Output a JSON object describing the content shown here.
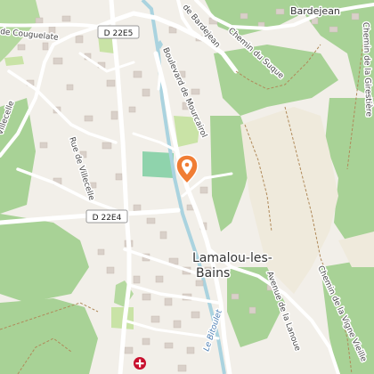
{
  "map": {
    "labels": {
      "road_coupeulate": "de Couguelate",
      "road_bardejean": "de Bardejean",
      "place_bardejean": "Bardejean",
      "road_chemin_suque": "Chemin du Suque",
      "road_girestiere": "Chemin de la Girestière",
      "road_mourcairol": "Boulevard de Mourcairol",
      "road_villecelle": "Rue de Villecelle",
      "road_villecelle_w": "Villecelle",
      "road_vigne_vieille": "Chemin de la Vigne Vieille",
      "road_lanoue": "Avenue de la Lanoue",
      "river_bitoulet": "Le Bitoulet",
      "town": "Lamalou-les-",
      "town2": "Bains"
    },
    "route_shields": {
      "d22e5": "D 22E5",
      "d22e4": "D 22E4"
    },
    "markers": {
      "selected_pin": "location-pin",
      "pharmacy": "pharmacy-cross"
    },
    "colors": {
      "background": "#f2efe9",
      "forest": "#a8d296",
      "meadow": "#c9e3a6",
      "road": "#ffffff",
      "building": "#d9d0c9",
      "water": "#aad3df",
      "pin": "#f07d34"
    }
  }
}
